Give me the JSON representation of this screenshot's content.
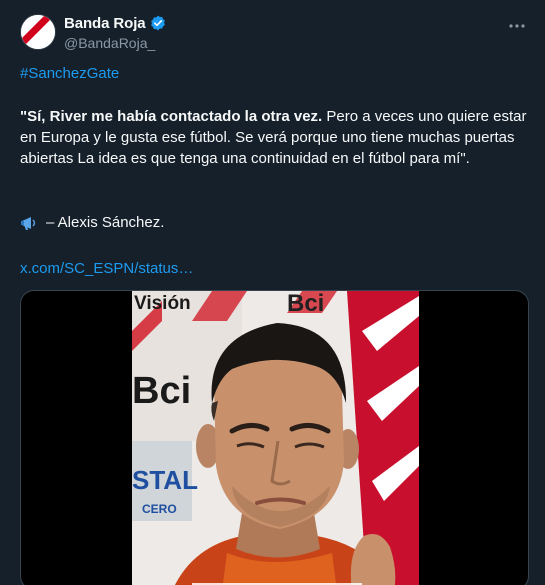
{
  "author": {
    "display_name": "Banda Roja",
    "handle": "@BandaRoja_",
    "verified": true
  },
  "tweet": {
    "hashtag": "#SanchezGate",
    "quote_bold": "\"Sí, River me había contactado la otra vez.",
    "quote_rest": "  Pero a veces uno quiere estar en Europa y le gusta ese fútbol. Se verá porque uno tiene muchas puertas abiertas La idea es que tenga una continuidad en el fútbol para mí\".",
    "signature": "– Alexis Sánchez.",
    "link": "x.com/SC_ESPN/status…"
  },
  "media": {
    "backdrop_text_top_left": "Visión",
    "backdrop_text_top_right": "Bci",
    "backdrop_text_mid_left": "Bci",
    "backdrop_text_beer": "STAL",
    "backdrop_text_beer_sub": "CERO"
  },
  "icons": {
    "verified": "verified-badge-icon",
    "more": "more-options-icon",
    "megaphone": "megaphone-icon"
  },
  "colors": {
    "background": "#15202b",
    "accent": "#1d9bf0",
    "text": "#f7f9f9",
    "muted": "#8b98a5",
    "brand_red": "#d0021b"
  }
}
